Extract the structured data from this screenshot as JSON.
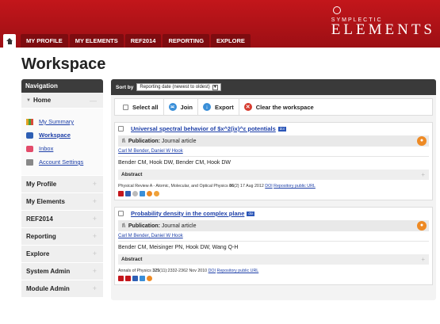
{
  "brand": {
    "small": "SYMPLECTIC",
    "big": "ELEMENTS"
  },
  "tabs": [
    "MY PROFILE",
    "MY ELEMENTS",
    "REF2014",
    "REPORTING",
    "EXPLORE"
  ],
  "page": {
    "title": "Workspace"
  },
  "nav": {
    "header": "Navigation",
    "home": "Home",
    "home_links": [
      {
        "label": "My Summary",
        "icon": "summary-icon"
      },
      {
        "label": "Workspace",
        "icon": "workspace-icon"
      },
      {
        "label": "Inbox",
        "icon": "inbox-icon"
      },
      {
        "label": "Account Settings",
        "icon": "settings-icon"
      }
    ],
    "sections": [
      "My Profile",
      "My Elements",
      "REF2014",
      "Reporting",
      "Explore",
      "System Admin",
      "Module Admin"
    ]
  },
  "sort": {
    "label": "Sort by",
    "selected": "Reporting date (newest to oldest)"
  },
  "actions": {
    "select_all": "Select all",
    "join": "Join",
    "export": "Export",
    "clear": "Clear the workspace"
  },
  "items": [
    {
      "title": "Universal spectral behavior of $x^2(ix)^ε potentials",
      "doi_badge": "doi",
      "pub_label": "Publication:",
      "pub_type": "Journal article",
      "author_links": "Carl M Bender, Daniel W Hook",
      "authors": "Bender CM, Hook DW, Bender CM, Hook DW",
      "abstract_label": "Abstract",
      "cite_text": "Physical Review A - Atomic, Molecular, and Optical Physics",
      "cite_vol": "86",
      "cite_rest": "(2) 17 Aug 2012",
      "doi_link": "DOI",
      "repo_link": "Repository public URL"
    },
    {
      "title": "Probability density in the complex plane",
      "doi_badge": "doi",
      "pub_label": "Publication:",
      "pub_type": "Journal article",
      "author_links": "Carl M Bender, Daniel W Hook",
      "authors": "Bender CM, Meisinger PN, Hook DW, Wang Q-H",
      "abstract_label": "Abstract",
      "cite_text": "Annals of Physics",
      "cite_vol": "325",
      "cite_rest": "(11):2332-2362 Nov 2010",
      "doi_link": "DOI",
      "repo_link": "Repository public URL"
    }
  ],
  "colors": {
    "header_red": "#b5141a",
    "tab_dark_red": "#7e0c10",
    "link_blue": "#1d3fa8",
    "orange": "#ee8a24"
  }
}
